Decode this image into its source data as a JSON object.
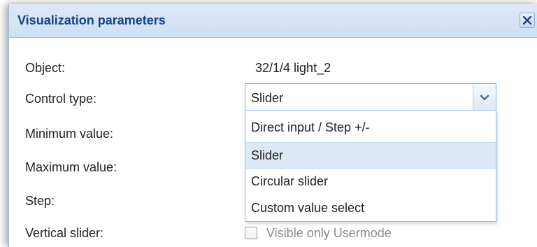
{
  "dialog": {
    "title": "Visualization parameters",
    "close_icon": "close-icon"
  },
  "form": {
    "object_label": "Object:",
    "object_value": "32/1/4 light_2",
    "control_type_label": "Control type:",
    "control_type_value": "Slider",
    "minimum_label": "Minimum value:",
    "maximum_label": "Maximum value:",
    "step_label": "Step:",
    "vertical_slider_label": "Vertical slider:",
    "visible_only_usermode_label": "Visible only Usermode",
    "visible_only_usermode_checked": false
  },
  "dropdown": {
    "options": [
      "Direct input / Step +/-",
      "Slider",
      "Circular slider",
      "Custom value select"
    ],
    "selected_index": 1,
    "trigger_icon": "chevron-down-icon"
  },
  "colors": {
    "title_text": "#15428b",
    "header_bg": "#dfe9f6",
    "border": "#99bbe8",
    "selected_option_bg": "#dfe8f6"
  }
}
